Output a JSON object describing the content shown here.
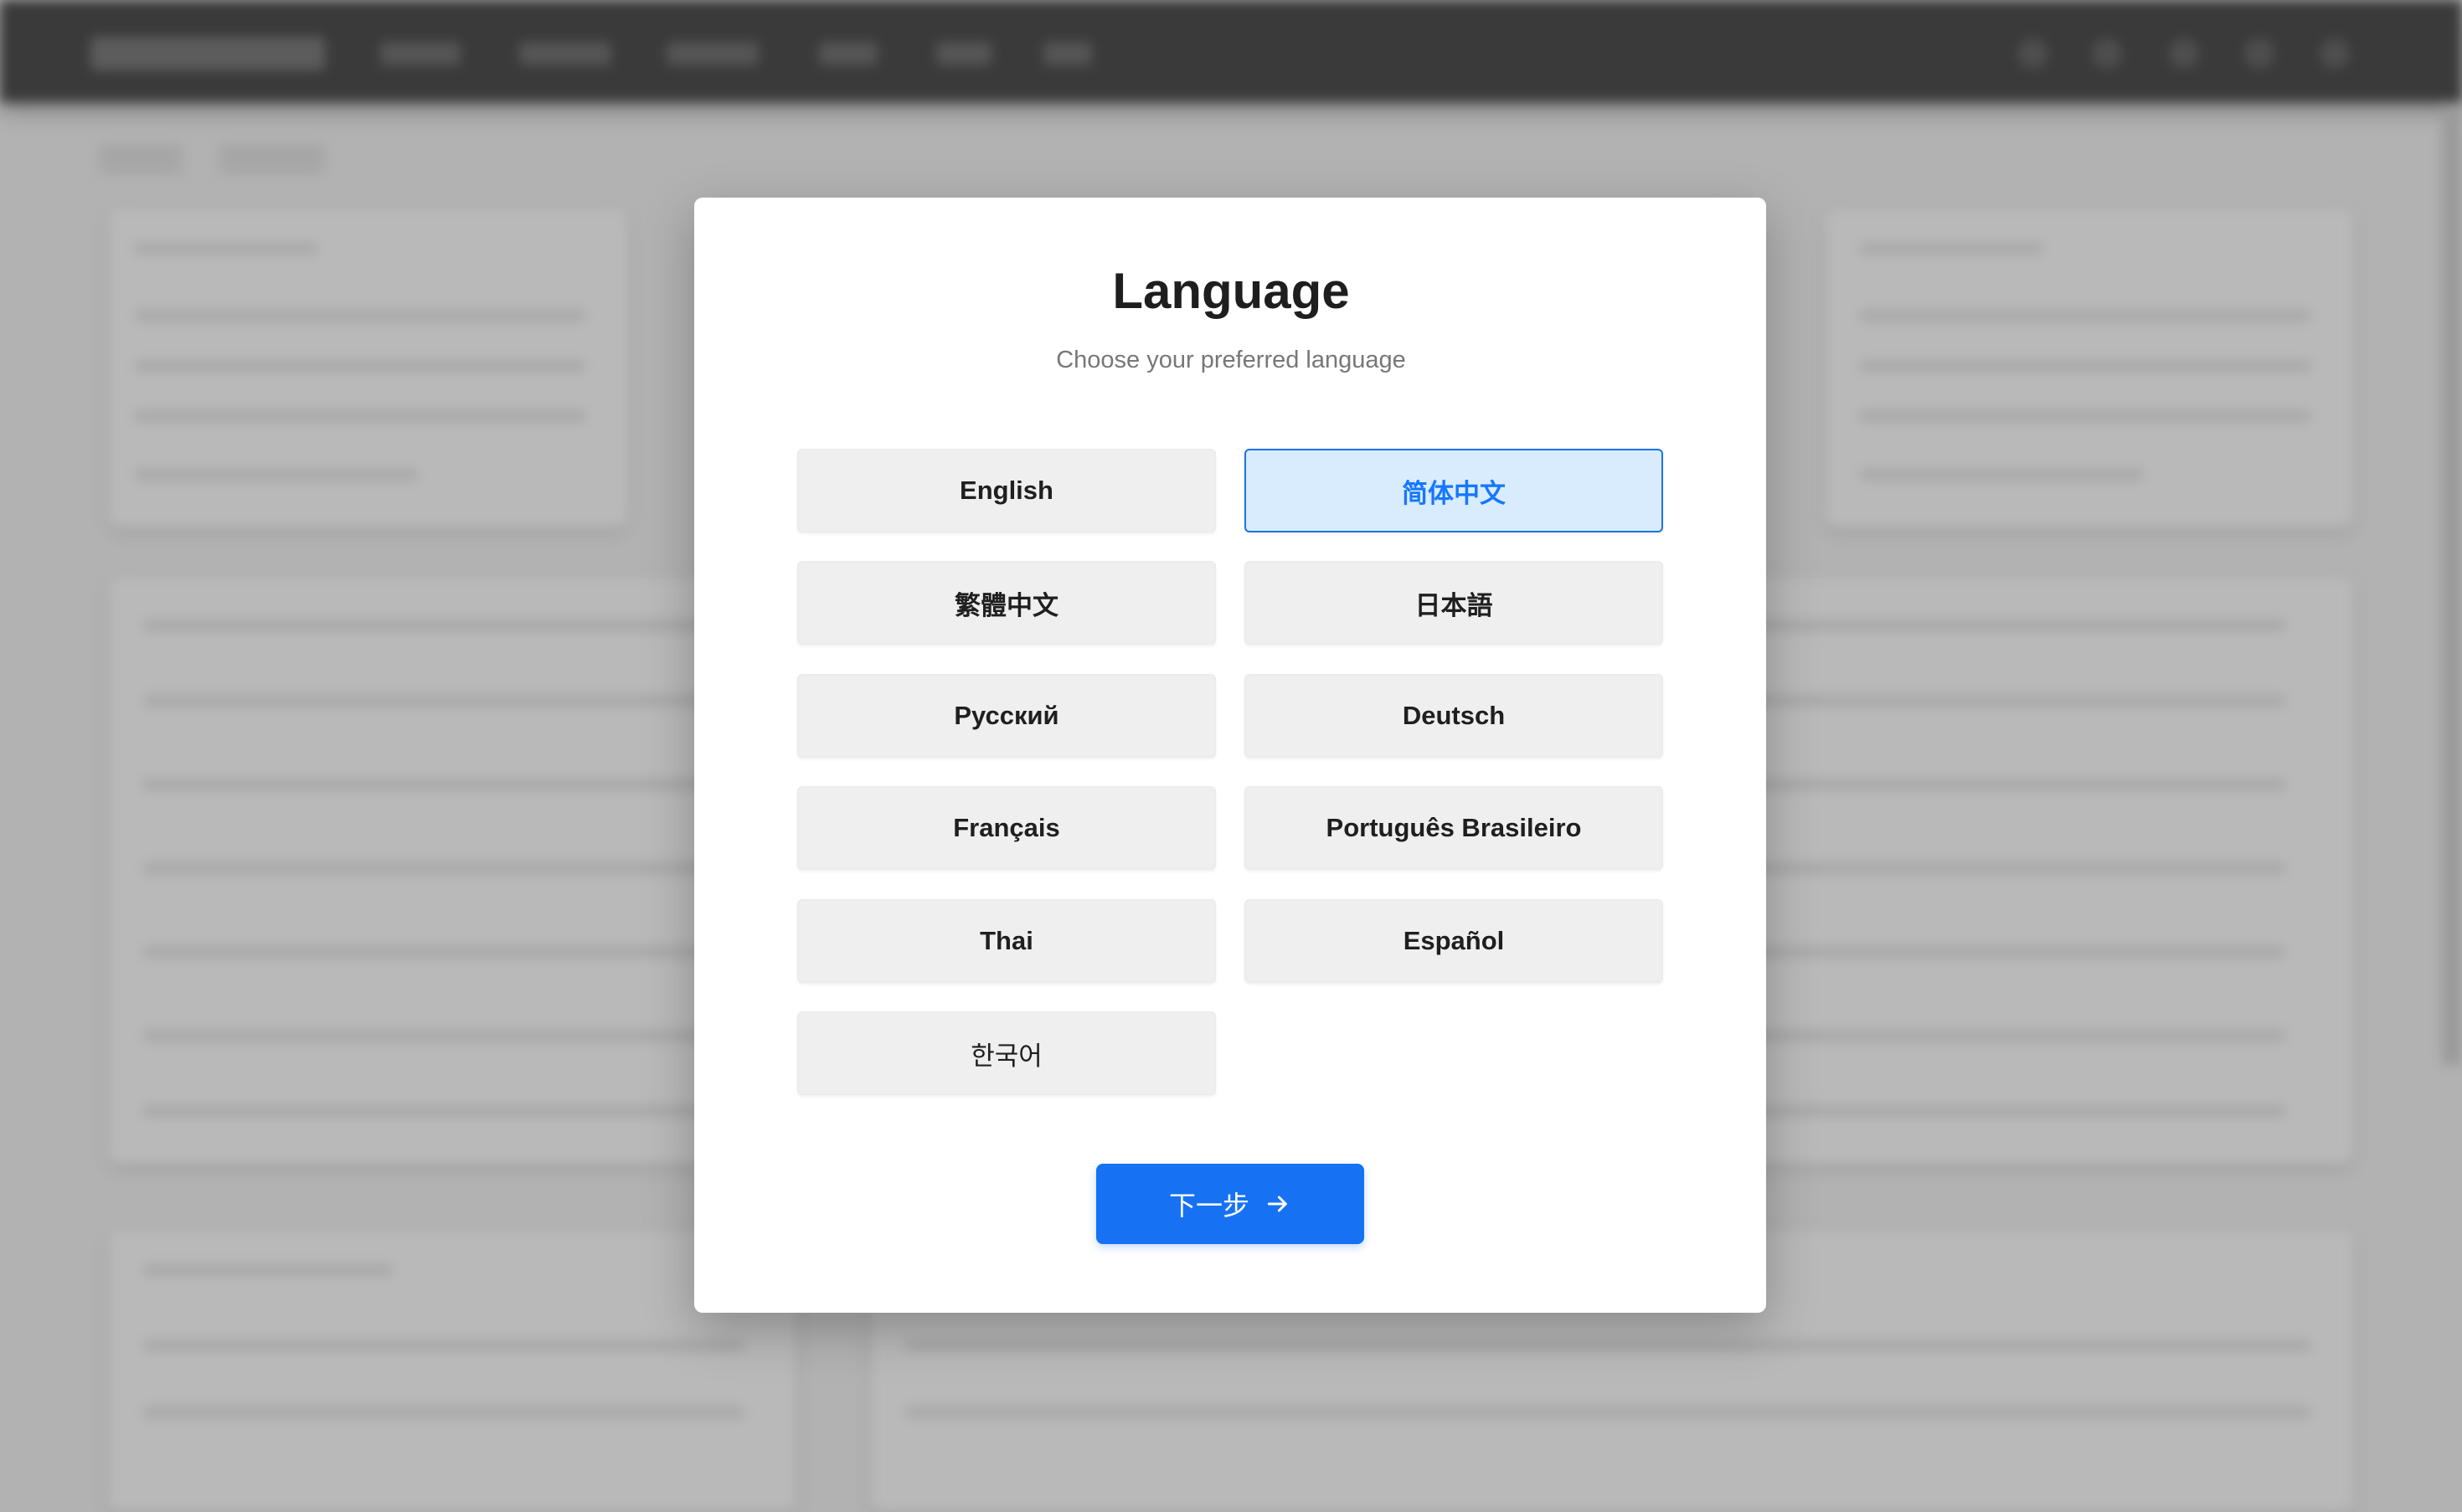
{
  "modal": {
    "title": "Language",
    "subtitle": "Choose your preferred language",
    "languages": [
      {
        "label": "English",
        "selected": false
      },
      {
        "label": "简体中文",
        "selected": true
      },
      {
        "label": "繁體中文",
        "selected": false
      },
      {
        "label": "日本語",
        "selected": false
      },
      {
        "label": "Русский",
        "selected": false
      },
      {
        "label": "Deutsch",
        "selected": false
      },
      {
        "label": "Français",
        "selected": false
      },
      {
        "label": "Português Brasileiro",
        "selected": false
      },
      {
        "label": "Thai",
        "selected": false
      },
      {
        "label": "Español",
        "selected": false
      },
      {
        "label": "한국어",
        "selected": false
      }
    ],
    "next_label": "下一步",
    "next_icon": "arrow-right-icon"
  },
  "colors": {
    "accent": "#1672f3",
    "selected_bg": "#d9ecfd",
    "selected_text": "#1677ff",
    "option_bg": "#efefef",
    "overlay": "#b2b2b2"
  }
}
